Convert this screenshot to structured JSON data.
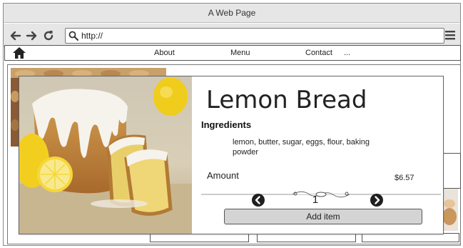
{
  "window": {
    "title": "A Web Page"
  },
  "toolbar": {
    "url": "http://"
  },
  "nav": {
    "items": [
      {
        "label": "About"
      },
      {
        "label": "Menu"
      },
      {
        "label": "Contact"
      },
      {
        "label": "..."
      }
    ]
  },
  "product": {
    "title": "Lemon Bread",
    "ingredients_label": "Ingredients",
    "ingredients": "lemon, butter, sugar, eggs, flour, baking powder",
    "amount_label": "Amount",
    "price": "$6.57",
    "quantity": "1",
    "add_label": "Add item"
  },
  "icons": {
    "back": "back-arrow-icon",
    "forward": "forward-arrow-icon",
    "reload": "reload-icon",
    "search": "search-icon",
    "menu": "hamburger-menu-icon",
    "home": "home-icon",
    "decrement": "chevron-left-circle-icon",
    "increment": "chevron-right-circle-icon"
  }
}
